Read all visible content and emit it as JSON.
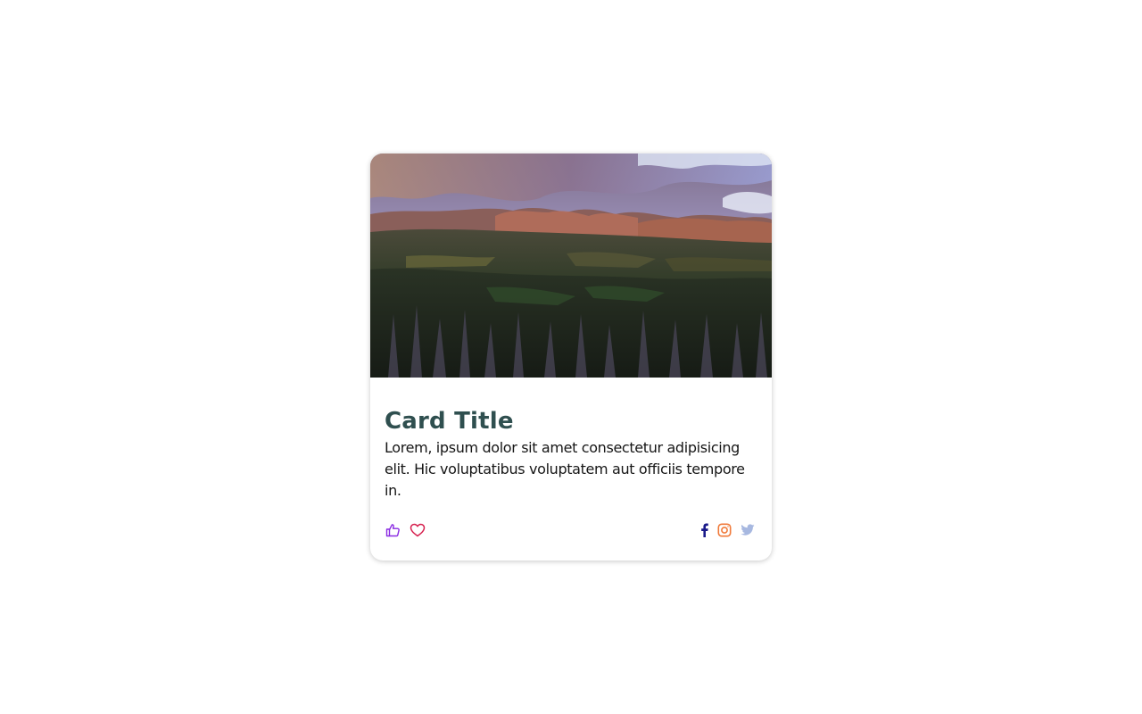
{
  "card": {
    "image": {
      "alt": "Mountain forest landscape at sunset"
    },
    "title": "Card Title",
    "text": "Lorem, ipsum dolor sit amet consectetur adipisicing elit. Hic voluptatibus voluptatem aut officiis tempore in.",
    "reactions": [
      {
        "icon": "thumbs-up-icon",
        "color": "#8a2be2"
      },
      {
        "icon": "heart-icon",
        "color": "#d6204e"
      }
    ],
    "socials": [
      {
        "icon": "facebook-icon",
        "color": "#1a1a8a"
      },
      {
        "icon": "instagram-icon",
        "color": "#f07a3a"
      },
      {
        "icon": "twitter-icon",
        "color": "#a7b8e0"
      }
    ]
  },
  "colors": {
    "title": "#2f4f4f",
    "text": "#161616",
    "card_bg": "#ffffff",
    "page_bg": "#ffffff"
  }
}
